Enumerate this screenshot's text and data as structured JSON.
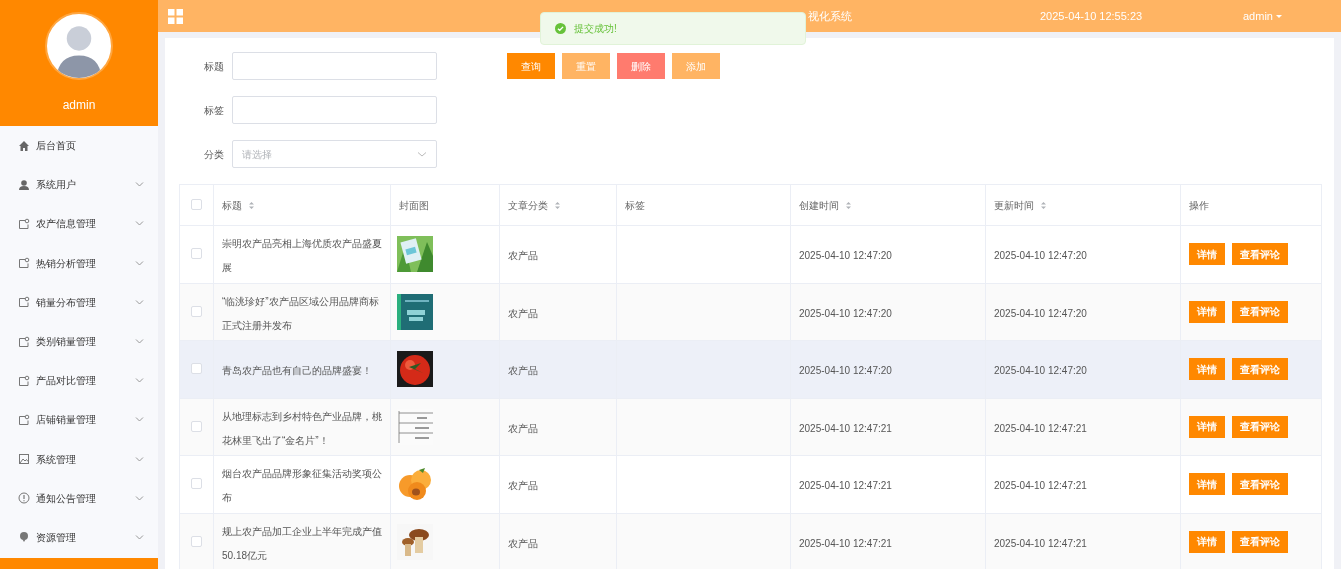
{
  "sidebar": {
    "user": "admin",
    "items": [
      {
        "label": "后台首页"
      },
      {
        "label": "系统用户",
        "expanded": false
      },
      {
        "label": "农产信息管理",
        "expanded": false
      },
      {
        "label": "热销分析管理",
        "expanded": false
      },
      {
        "label": "销量分布管理",
        "expanded": false
      },
      {
        "label": "类别销量管理",
        "expanded": false
      },
      {
        "label": "产品对比管理",
        "expanded": false
      },
      {
        "label": "店铺销量管理",
        "expanded": false
      },
      {
        "label": "系统管理",
        "expanded": false
      },
      {
        "label": "通知公告管理",
        "expanded": false
      },
      {
        "label": "资源管理",
        "expanded": false
      }
    ]
  },
  "header": {
    "title": "视化系统",
    "datetime": "2025-04-10 12:55:23",
    "user": "admin"
  },
  "toast": {
    "message": "提交成功!"
  },
  "filters": [
    {
      "label": "标题",
      "kind": "text"
    },
    {
      "label": "标签",
      "kind": "text"
    },
    {
      "label": "分类",
      "kind": "select",
      "placeholder": "请选择"
    }
  ],
  "actions": [
    {
      "label": "查询",
      "kind": "primary"
    },
    {
      "label": "重置",
      "kind": "light"
    },
    {
      "label": "删除",
      "kind": "danger"
    },
    {
      "label": "添加",
      "kind": "light"
    }
  ],
  "table": {
    "select_all": {
      "checked": false
    },
    "columns": [
      {
        "label": "标题",
        "sortable": true
      },
      {
        "label": "封面图",
        "sortable": false
      },
      {
        "label": "文章分类",
        "sortable": true
      },
      {
        "label": "标签",
        "sortable": false
      },
      {
        "label": "创建时间",
        "sortable": true
      },
      {
        "label": "更新时间",
        "sortable": true
      },
      {
        "label": "操作",
        "sortable": false
      }
    ],
    "rows": [
      {
        "checked": false,
        "hovered": false,
        "title": "崇明农产品亮相上海优质农产品盛夏展",
        "category": "农产品",
        "created": "2025-04-10 12:47:20",
        "updated": "2025-04-10 12:47:20",
        "buttons": [
          "详情",
          "查看评论"
        ]
      },
      {
        "checked": false,
        "hovered": false,
        "title": "“临洮珍好”农产品区域公用品牌商标正式注册并发布",
        "category": "农产品",
        "created": "2025-04-10 12:47:20",
        "updated": "2025-04-10 12:47:20",
        "buttons": [
          "详情",
          "查看评论"
        ]
      },
      {
        "checked": false,
        "hovered": true,
        "title": "青岛农产品也有自己的品牌盛宴！",
        "category": "农产品",
        "created": "2025-04-10 12:47:20",
        "updated": "2025-04-10 12:47:20",
        "buttons": [
          "详情",
          "查看评论"
        ]
      },
      {
        "checked": false,
        "hovered": false,
        "title": "从地理标志到乡村特色产业品牌，桃花林里飞出了“金名片”！",
        "category": "农产品",
        "created": "2025-04-10 12:47:21",
        "updated": "2025-04-10 12:47:21",
        "buttons": [
          "详情",
          "查看评论"
        ]
      },
      {
        "checked": false,
        "hovered": false,
        "title": "烟台农产品品牌形象征集活动奖项公布",
        "category": "农产品",
        "created": "2025-04-10 12:47:21",
        "updated": "2025-04-10 12:47:21",
        "buttons": [
          "详情",
          "查看评论"
        ]
      },
      {
        "checked": false,
        "hovered": false,
        "title": "规上农产品加工企业上半年完成产值50.18亿元",
        "category": "农产品",
        "created": "2025-04-10 12:47:21",
        "updated": "2025-04-10 12:47:21",
        "buttons": [
          "详情",
          "查看评论"
        ]
      }
    ]
  }
}
